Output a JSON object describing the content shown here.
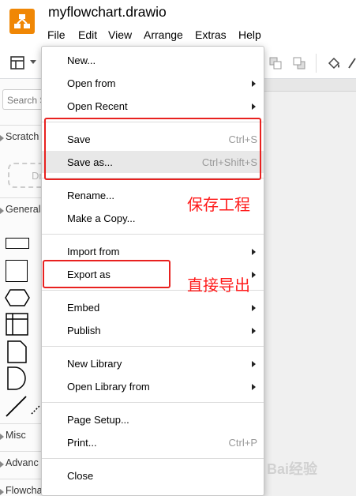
{
  "app": {
    "title": "myflowchart.drawio",
    "logo_icon": "drawio-logo-icon",
    "accent_color": "#f08705"
  },
  "menubar": {
    "items": [
      "File",
      "Edit",
      "View",
      "Arrange",
      "Extras",
      "Help"
    ]
  },
  "sidebar": {
    "search_placeholder": "Search S",
    "scratchpad": "Scratch",
    "drop_hint": "Dr",
    "general": "General",
    "misc": "Misc",
    "advanced": "Advanc",
    "flowchart": "Flowchart"
  },
  "file_menu": {
    "items": [
      {
        "label": "New...",
        "shortcut": "",
        "submenu": false
      },
      {
        "label": "Open from",
        "shortcut": "",
        "submenu": true
      },
      {
        "label": "Open Recent",
        "shortcut": "",
        "submenu": true
      },
      {
        "label": "Save",
        "shortcut": "Ctrl+S",
        "submenu": false
      },
      {
        "label": "Save as...",
        "shortcut": "Ctrl+Shift+S",
        "submenu": false,
        "highlighted": true
      },
      {
        "label": "Rename...",
        "shortcut": "",
        "submenu": false
      },
      {
        "label": "Make a Copy...",
        "shortcut": "",
        "submenu": false
      },
      {
        "label": "Import from",
        "shortcut": "",
        "submenu": true
      },
      {
        "label": "Export as",
        "shortcut": "",
        "submenu": true
      },
      {
        "label": "Embed",
        "shortcut": "",
        "submenu": true
      },
      {
        "label": "Publish",
        "shortcut": "",
        "submenu": true
      },
      {
        "label": "New Library",
        "shortcut": "",
        "submenu": true
      },
      {
        "label": "Open Library from",
        "shortcut": "",
        "submenu": true
      },
      {
        "label": "Page Setup...",
        "shortcut": "",
        "submenu": false
      },
      {
        "label": "Print...",
        "shortcut": "Ctrl+P",
        "submenu": false
      },
      {
        "label": "Close",
        "shortcut": "",
        "submenu": false
      }
    ]
  },
  "annotations": {
    "save_note": "保存工程",
    "export_note": "直接导出",
    "color": "#e8211f"
  },
  "watermark": {
    "text": "Bai经验"
  }
}
